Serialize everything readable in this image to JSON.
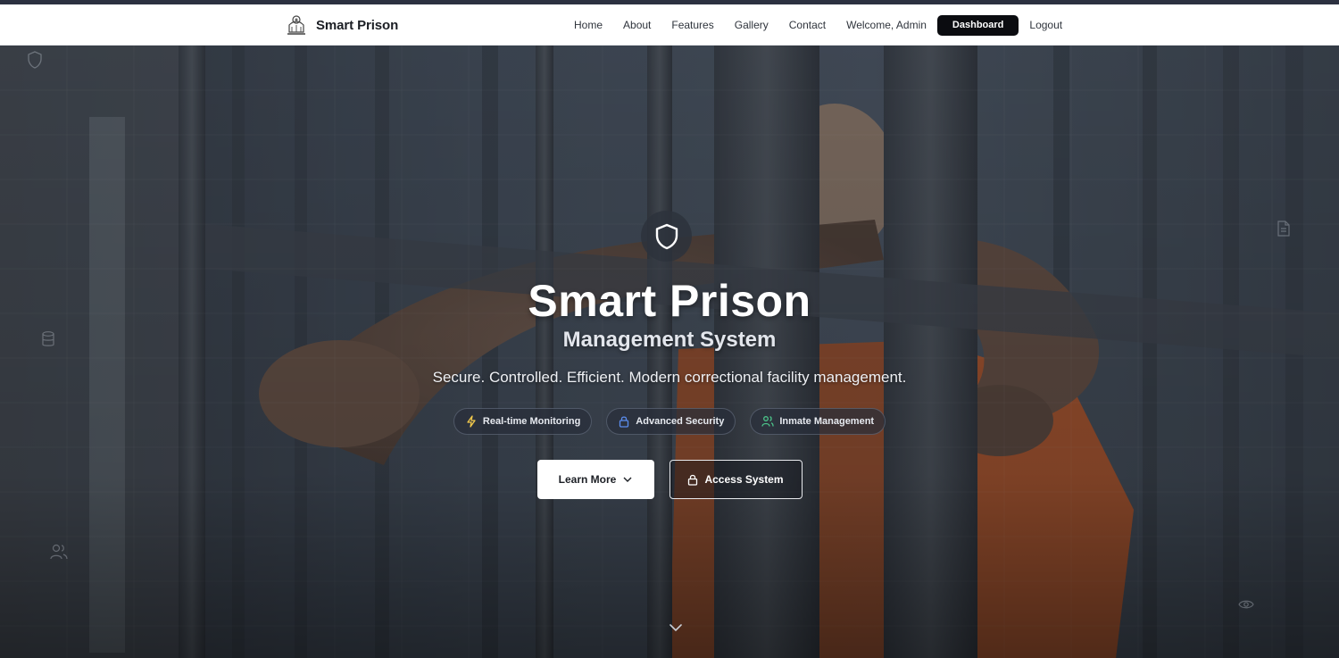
{
  "brand": {
    "name": "Smart Prison",
    "logo": "state-emblem-icon"
  },
  "nav": {
    "links": [
      "Home",
      "About",
      "Features",
      "Gallery",
      "Contact"
    ],
    "welcome": "Welcome, Admin",
    "dashboard": "Dashboard",
    "logout": "Logout"
  },
  "hero": {
    "icon": "shield-icon",
    "title": "Smart Prison",
    "subtitle": "Management System",
    "tagline": "Secure. Controlled. Efficient. Modern correctional facility management.",
    "badges": [
      {
        "label": "Real-time Monitoring",
        "icon": "lightning-icon",
        "color": "#f2c94c"
      },
      {
        "label": "Advanced Security",
        "icon": "lock-icon",
        "color": "#5b8def"
      },
      {
        "label": "Inmate Management",
        "icon": "users-icon",
        "color": "#4cc38a"
      }
    ],
    "learn_more": "Learn More",
    "access_system": "Access System"
  },
  "colors": {
    "nav_bg": "#ffffff",
    "dashboard_bg": "#0b0c10",
    "uniform_orange": "#d9642a"
  }
}
